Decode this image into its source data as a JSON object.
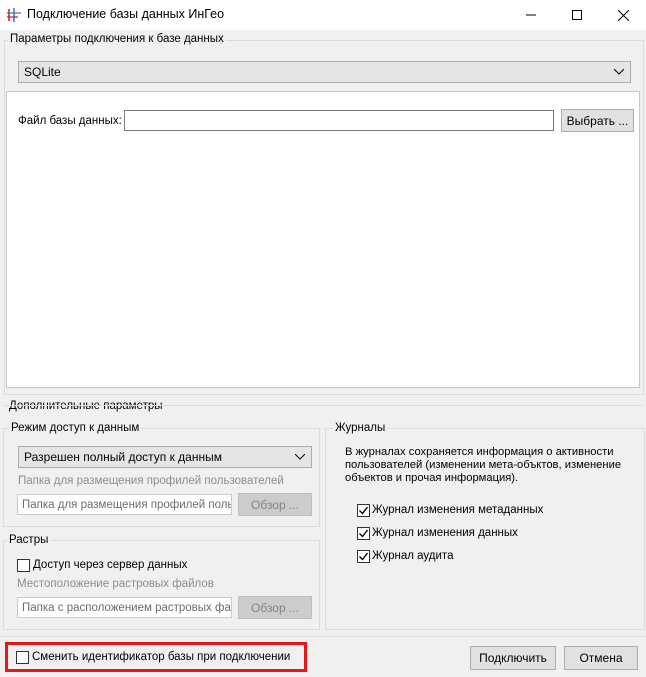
{
  "window": {
    "title": "Подключение базы данных ИнГео"
  },
  "connection": {
    "group_title": "Параметры подключения к базе данных",
    "provider": "SQLite",
    "file_label": "Файл базы данных:",
    "file_value": "",
    "browse_label": "Выбрать ..."
  },
  "additional": {
    "group_title": "Дополнительные параметры",
    "access": {
      "group_title": "Режим доступ к данным",
      "mode": "Разрешен полный доступ к данным",
      "profiles_label": "Папка для размещения профилей пользователей",
      "profiles_placeholder": "Папка для размещения профилей пользователей",
      "browse_label": "Обзор ..."
    },
    "rasters": {
      "group_title": "Растры",
      "server_access_label": "Доступ через сервер данных",
      "location_label": "Местоположение растровых файлов",
      "location_placeholder": "Папка с расположением растровых файлов",
      "browse_label": "Обзор ..."
    },
    "logs": {
      "group_title": "Журналы",
      "description": "В журналах сохраняется информация о активности пользователей (изменении мета-объктов, изменение объектов и прочая информация).",
      "items": [
        {
          "label": "Журнал изменения метаданных",
          "checked": true
        },
        {
          "label": "Журнал изменения данных",
          "checked": true
        },
        {
          "label": "Журнал аудита",
          "checked": true
        }
      ]
    }
  },
  "footer": {
    "change_id_label": "Сменить идентификатор базы при подключении",
    "connect_label": "Подключить",
    "cancel_label": "Отмена"
  },
  "colors": {
    "highlight": "#e8141c"
  }
}
